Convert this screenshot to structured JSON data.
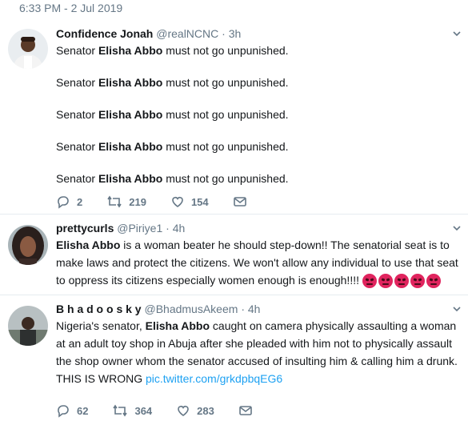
{
  "timestamp": "6:33 PM - 2 Jul 2019",
  "tweets": [
    {
      "display_name": "Confidence Jonah",
      "handle": "@realNCNC",
      "dot": "·",
      "age": "3h",
      "lines": [
        {
          "pre": "Senator ",
          "bold": "Elisha Abbo",
          "post": " must not go unpunished."
        },
        {
          "pre": "Senator ",
          "bold": "Elisha Abbo",
          "post": " must not go unpunished."
        },
        {
          "pre": "Senator ",
          "bold": "Elisha Abbo",
          "post": " must not go unpunished."
        },
        {
          "pre": "Senator ",
          "bold": "Elisha Abbo",
          "post": " must not go unpunished."
        },
        {
          "pre": "Senator ",
          "bold": "Elisha Abbo",
          "post": " must not go unpunished."
        }
      ],
      "replies": "2",
      "retweets": "219",
      "likes": "154"
    },
    {
      "display_name": "prettycurls",
      "handle": "@Piriye1",
      "dot": "·",
      "age": "4h",
      "bold": "Elisha Abbo",
      "text": " is a woman beater he should step-down!! The senatorial seat is to make laws and protect the citizens. We won't allow any individual to use that seat to oppress its citizens especially women enough is enough!!!!"
    },
    {
      "display_name": "B h a d o o s k y",
      "handle": "@BhadmusAkeem",
      "dot": "·",
      "age": "4h",
      "pre": "Nigeria's senator, ",
      "bold": "Elisha Abbo",
      "text": " caught on camera physically assaulting a woman at an adult toy shop in Abuja after she pleaded with him not to physically assault the shop owner whom the senator accused of insulting him & calling him a drunk. THIS IS WRONG ",
      "link": "pic.twitter.com/grkdpbqEG6",
      "replies": "62",
      "retweets": "364",
      "likes": "283"
    }
  ],
  "colors": {
    "text": "#14171a",
    "muted": "#657786",
    "link": "#1da1f2",
    "angry_emoji": "#e0245e"
  },
  "icons": [
    "reply-icon",
    "retweet-icon",
    "like-icon",
    "message-icon",
    "chevron-down-icon",
    "angry-face-emoji"
  ]
}
